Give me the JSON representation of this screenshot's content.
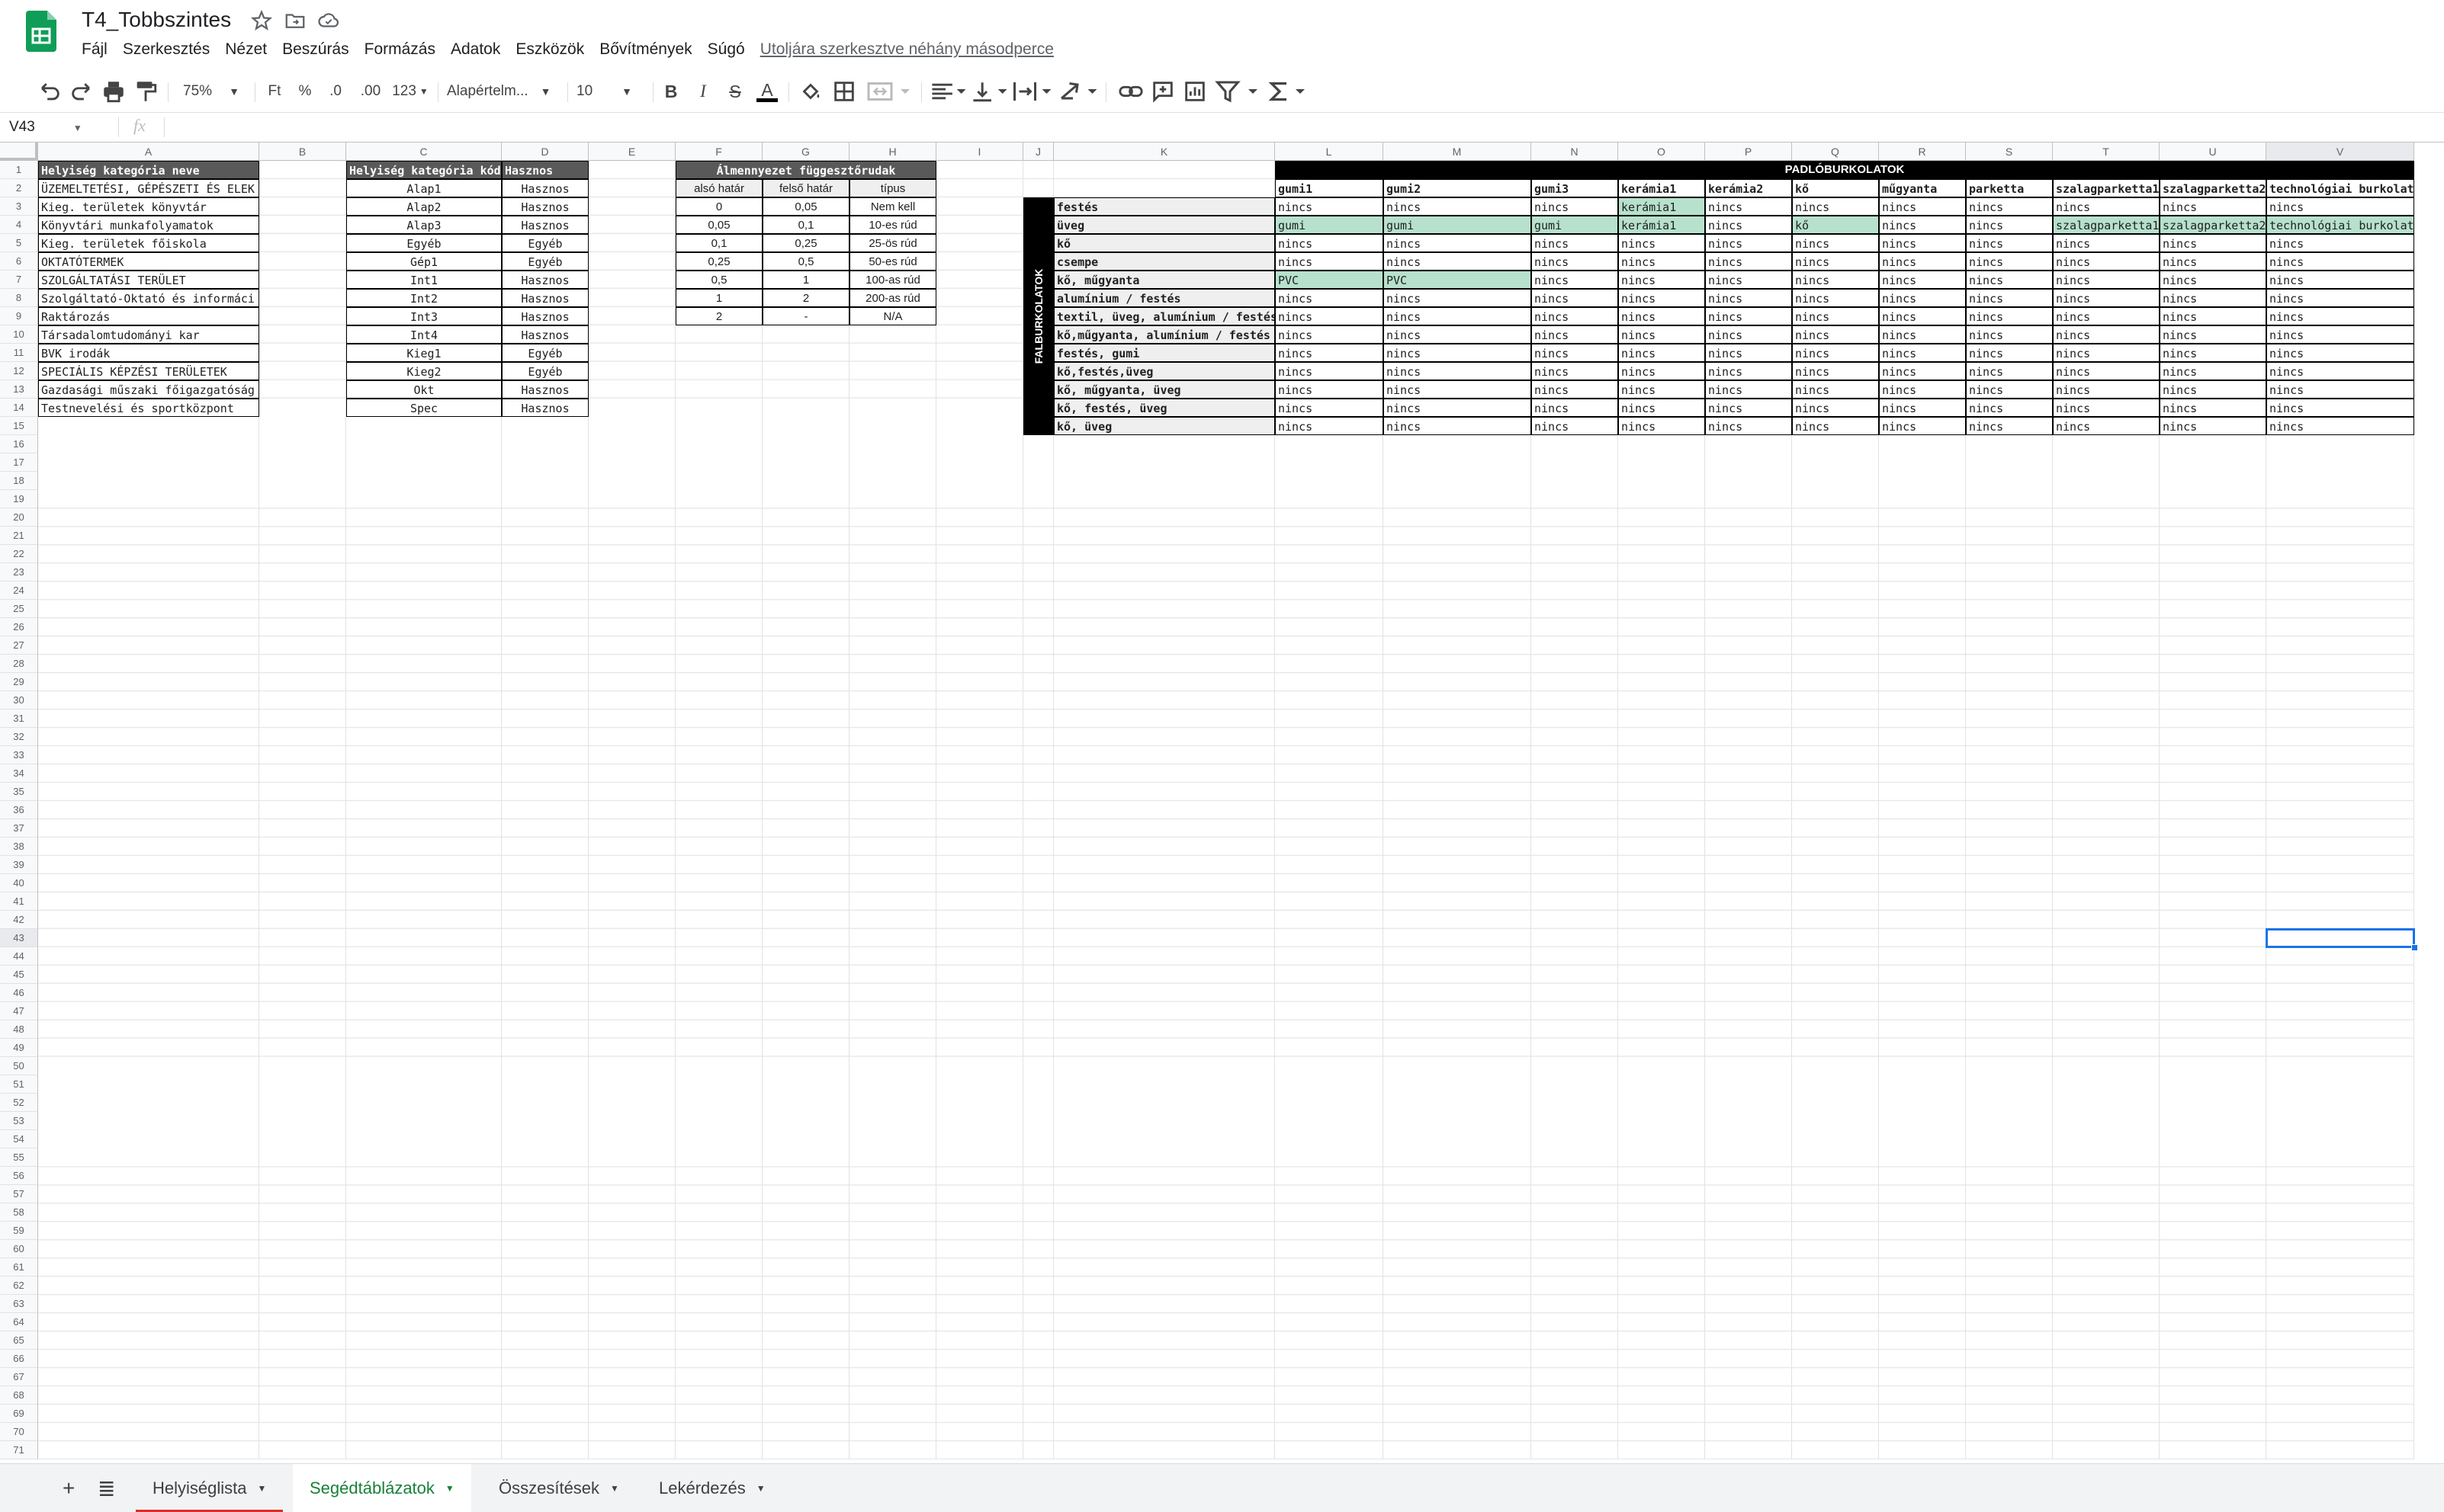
{
  "app": {
    "title": "T4_Tobbszintes",
    "menu": [
      "Fájl",
      "Szerkesztés",
      "Nézet",
      "Beszúrás",
      "Formázás",
      "Adatok",
      "Eszközök",
      "Bővítmények",
      "Súgó"
    ],
    "last_edit": "Utoljára szerkesztve néhány másodperce"
  },
  "toolbar": {
    "zoom": "75%",
    "currency": "Ft",
    "percent": "%",
    "dec_less": ".0",
    "dec_more": ".00",
    "more_formats": "123",
    "font": "Alapértelm...",
    "font_size": "10",
    "bold": "B",
    "italic": "I",
    "strike": "S",
    "text_color": "A"
  },
  "formula_bar": {
    "name_box": "V43",
    "fx": "fx",
    "value": ""
  },
  "grid": {
    "columns": [
      "A",
      "B",
      "C",
      "D",
      "E",
      "F",
      "G",
      "H",
      "I",
      "J",
      "K",
      "L",
      "M",
      "N",
      "O",
      "P",
      "Q",
      "R",
      "S",
      "T",
      "U",
      "V"
    ],
    "row_count": 71,
    "selected_cell": "V43",
    "table_categories": {
      "headers": [
        "Helyiség kategória neve",
        "Helyiség kategória kód",
        "Hasznos"
      ],
      "rows": [
        [
          "ÜZEMELTETÉSI, GÉPÉSZETI ÉS ELEK",
          "Alap1",
          "Hasznos"
        ],
        [
          "Kieg. területek könyvtár",
          "Alap2",
          "Hasznos"
        ],
        [
          "Könyvtári munkafolyamatok",
          "Alap3",
          "Hasznos"
        ],
        [
          "Kieg. területek főiskola",
          "Egyéb",
          "Egyéb"
        ],
        [
          "OKTATÓTERMEK",
          "Gép1",
          "Egyéb"
        ],
        [
          "SZOLGÁLTATÁSI TERÜLET",
          "Int1",
          "Hasznos"
        ],
        [
          "Szolgáltató-Oktató és informáci",
          "Int2",
          "Hasznos"
        ],
        [
          "Raktározás",
          "Int3",
          "Hasznos"
        ],
        [
          "Társadalomtudományi kar",
          "Int4",
          "Hasznos"
        ],
        [
          "BVK irodák",
          "Kieg1",
          "Egyéb"
        ],
        [
          "SPECIÁLIS KÉPZÉSI TERÜLETEK",
          "Kieg2",
          "Egyéb"
        ],
        [
          "Gazdasági műszaki főigazgatóság",
          "Okt",
          "Hasznos"
        ],
        [
          "Testnevelési és sportközpont",
          "Spec",
          "Hasznos"
        ]
      ]
    },
    "table_ceiling": {
      "title": "Álmennyezet függesztőrudak",
      "headers": [
        "alsó határ",
        "felső határ",
        "típus"
      ],
      "rows": [
        [
          "0",
          "0,05",
          "Nem kell"
        ],
        [
          "0,05",
          "0,1",
          "10-es rúd"
        ],
        [
          "0,1",
          "0,25",
          "25-ös rúd"
        ],
        [
          "0,25",
          "0,5",
          "50-es rúd"
        ],
        [
          "0,5",
          "1",
          "100-as rúd"
        ],
        [
          "1",
          "2",
          "200-as rúd"
        ],
        [
          "2",
          "-",
          "N/A"
        ]
      ]
    },
    "table_cladding": {
      "top_title": "PADLÓBURKOLATOK",
      "side_title": "FALBURKOLATOK",
      "floor_headers": [
        "gumi1",
        "gumi2",
        "gumi3",
        "kerámia1",
        "kerámia2",
        "kő",
        "műgyanta",
        "parketta",
        "szalagparketta1",
        "szalagparketta2",
        "technológiai burkolat"
      ],
      "wall_rows": [
        {
          "label": "festés",
          "cells": [
            "nincs",
            "nincs",
            "nincs",
            "kerámia1",
            "nincs",
            "nincs",
            "nincs",
            "nincs",
            "nincs",
            "nincs",
            "nincs"
          ]
        },
        {
          "label": "üveg",
          "cells": [
            "gumi",
            "gumi",
            "gumi",
            "kerámia1",
            "nincs",
            "kő",
            "nincs",
            "nincs",
            "szalagparketta1",
            "szalagparketta2",
            "technológiai burkolat"
          ]
        },
        {
          "label": "kő",
          "cells": [
            "nincs",
            "nincs",
            "nincs",
            "nincs",
            "nincs",
            "nincs",
            "nincs",
            "nincs",
            "nincs",
            "nincs",
            "nincs"
          ]
        },
        {
          "label": "csempe",
          "cells": [
            "nincs",
            "nincs",
            "nincs",
            "nincs",
            "nincs",
            "nincs",
            "nincs",
            "nincs",
            "nincs",
            "nincs",
            "nincs"
          ]
        },
        {
          "label": "kő, műgyanta",
          "cells": [
            "PVC",
            "PVC",
            "nincs",
            "nincs",
            "nincs",
            "nincs",
            "nincs",
            "nincs",
            "nincs",
            "nincs",
            "nincs"
          ]
        },
        {
          "label": "alumínium / festés",
          "cells": [
            "nincs",
            "nincs",
            "nincs",
            "nincs",
            "nincs",
            "nincs",
            "nincs",
            "nincs",
            "nincs",
            "nincs",
            "nincs"
          ]
        },
        {
          "label": "textil, üveg, alumínium / festés",
          "cells": [
            "nincs",
            "nincs",
            "nincs",
            "nincs",
            "nincs",
            "nincs",
            "nincs",
            "nincs",
            "nincs",
            "nincs",
            "nincs"
          ]
        },
        {
          "label": "kő,műgyanta, alumínium / festés",
          "cells": [
            "nincs",
            "nincs",
            "nincs",
            "nincs",
            "nincs",
            "nincs",
            "nincs",
            "nincs",
            "nincs",
            "nincs",
            "nincs"
          ]
        },
        {
          "label": "festés, gumi",
          "cells": [
            "nincs",
            "nincs",
            "nincs",
            "nincs",
            "nincs",
            "nincs",
            "nincs",
            "nincs",
            "nincs",
            "nincs",
            "nincs"
          ]
        },
        {
          "label": "kő,festés,üveg",
          "cells": [
            "nincs",
            "nincs",
            "nincs",
            "nincs",
            "nincs",
            "nincs",
            "nincs",
            "nincs",
            "nincs",
            "nincs",
            "nincs"
          ]
        },
        {
          "label": "kő, műgyanta, üveg",
          "cells": [
            "nincs",
            "nincs",
            "nincs",
            "nincs",
            "nincs",
            "nincs",
            "nincs",
            "nincs",
            "nincs",
            "nincs",
            "nincs"
          ]
        },
        {
          "label": "kő, festés, üveg",
          "cells": [
            "nincs",
            "nincs",
            "nincs",
            "nincs",
            "nincs",
            "nincs",
            "nincs",
            "nincs",
            "nincs",
            "nincs",
            "nincs"
          ]
        },
        {
          "label": "kő, üveg",
          "cells": [
            "nincs",
            "nincs",
            "nincs",
            "nincs",
            "nincs",
            "nincs",
            "nincs",
            "nincs",
            "nincs",
            "nincs",
            "nincs"
          ]
        }
      ],
      "highlighted": [
        [
          0,
          3
        ],
        [
          1,
          0
        ],
        [
          1,
          1
        ],
        [
          1,
          2
        ],
        [
          1,
          3
        ],
        [
          1,
          5
        ],
        [
          1,
          8
        ],
        [
          1,
          9
        ],
        [
          1,
          10
        ],
        [
          4,
          0
        ],
        [
          4,
          1
        ]
      ]
    }
  },
  "sheets": {
    "tabs": [
      "Helyiséglista",
      "Segédtáblázatok",
      "Összesítések",
      "Lekérdezés"
    ],
    "active": 1
  },
  "colors": {
    "header_dark": "#595959",
    "title_black": "#000000",
    "sub_header": "#efefef",
    "highlight": "#b7e1cd",
    "selection": "#1a73e8",
    "active_tab": "#188038",
    "tab_underline": "#d93025"
  }
}
